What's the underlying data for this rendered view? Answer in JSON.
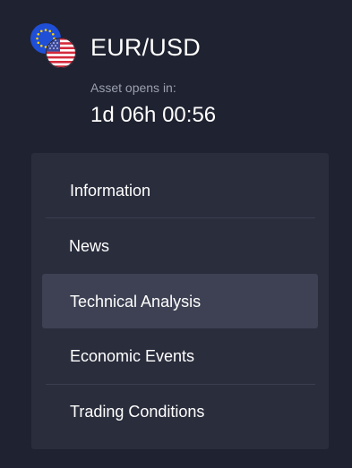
{
  "asset": {
    "title": "EUR/USD",
    "opens_label": "Asset opens in:",
    "countdown": "1d 06h 00:56",
    "flag_icons": [
      "eu-flag-icon",
      "us-flag-icon"
    ]
  },
  "menu": {
    "items": [
      {
        "label": "Information"
      },
      {
        "label": "News"
      },
      {
        "label": "Technical Analysis",
        "active": true
      },
      {
        "label": "Economic Events"
      },
      {
        "label": "Trading Conditions"
      }
    ]
  },
  "colors": {
    "background": "#1f2230",
    "panel": "#2a2d3c",
    "active_item": "#3d4153",
    "divider": "#3a3e4f",
    "muted_text": "#9aa0b0",
    "text": "#ffffff"
  }
}
